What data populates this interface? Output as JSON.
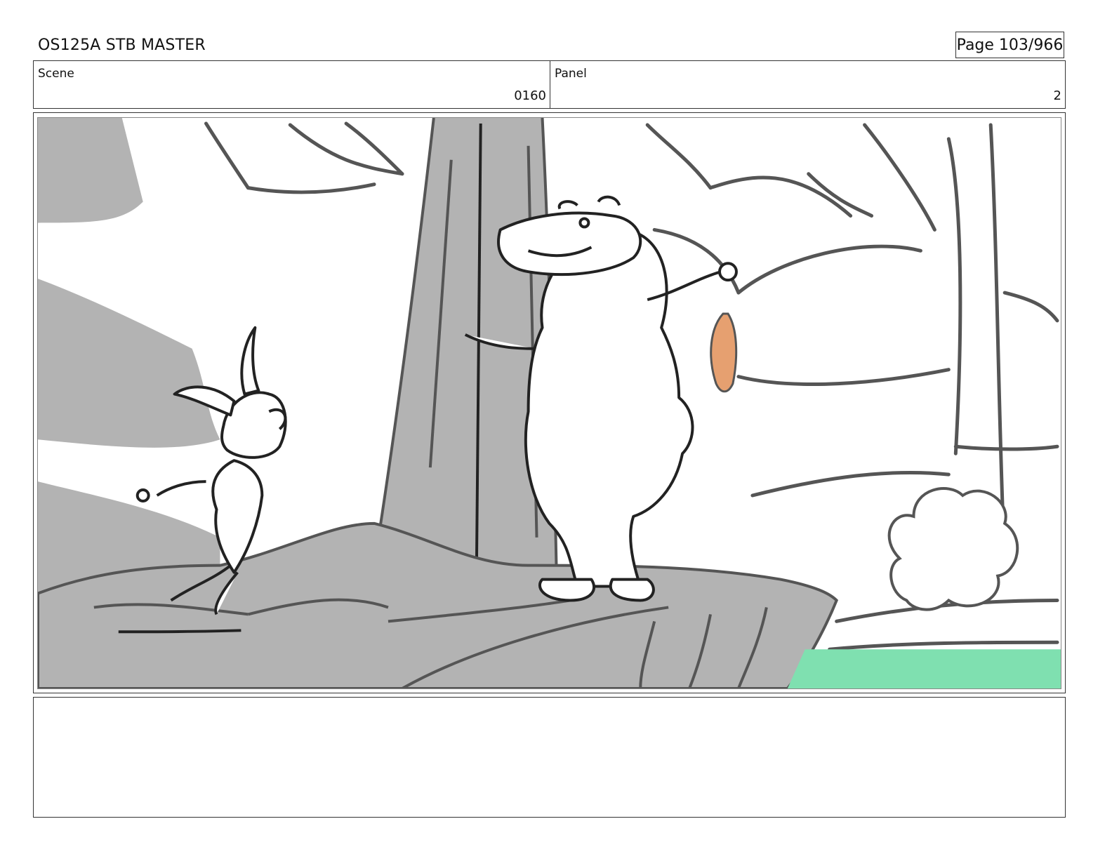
{
  "header": {
    "doc_title": "OS125A STB MASTER",
    "page_label": "Page 103/966"
  },
  "info": {
    "scene_label": "Scene",
    "scene_value": "0160",
    "panel_label": "Panel",
    "panel_value": "2"
  },
  "frame": {
    "colors": {
      "shadow_gray": "#b3b3b3",
      "line_dark": "#555555",
      "water_green": "#7fe0b0",
      "fish_orange": "#e6a070",
      "paper": "#ffffff"
    }
  },
  "notes": {
    "text": ""
  }
}
